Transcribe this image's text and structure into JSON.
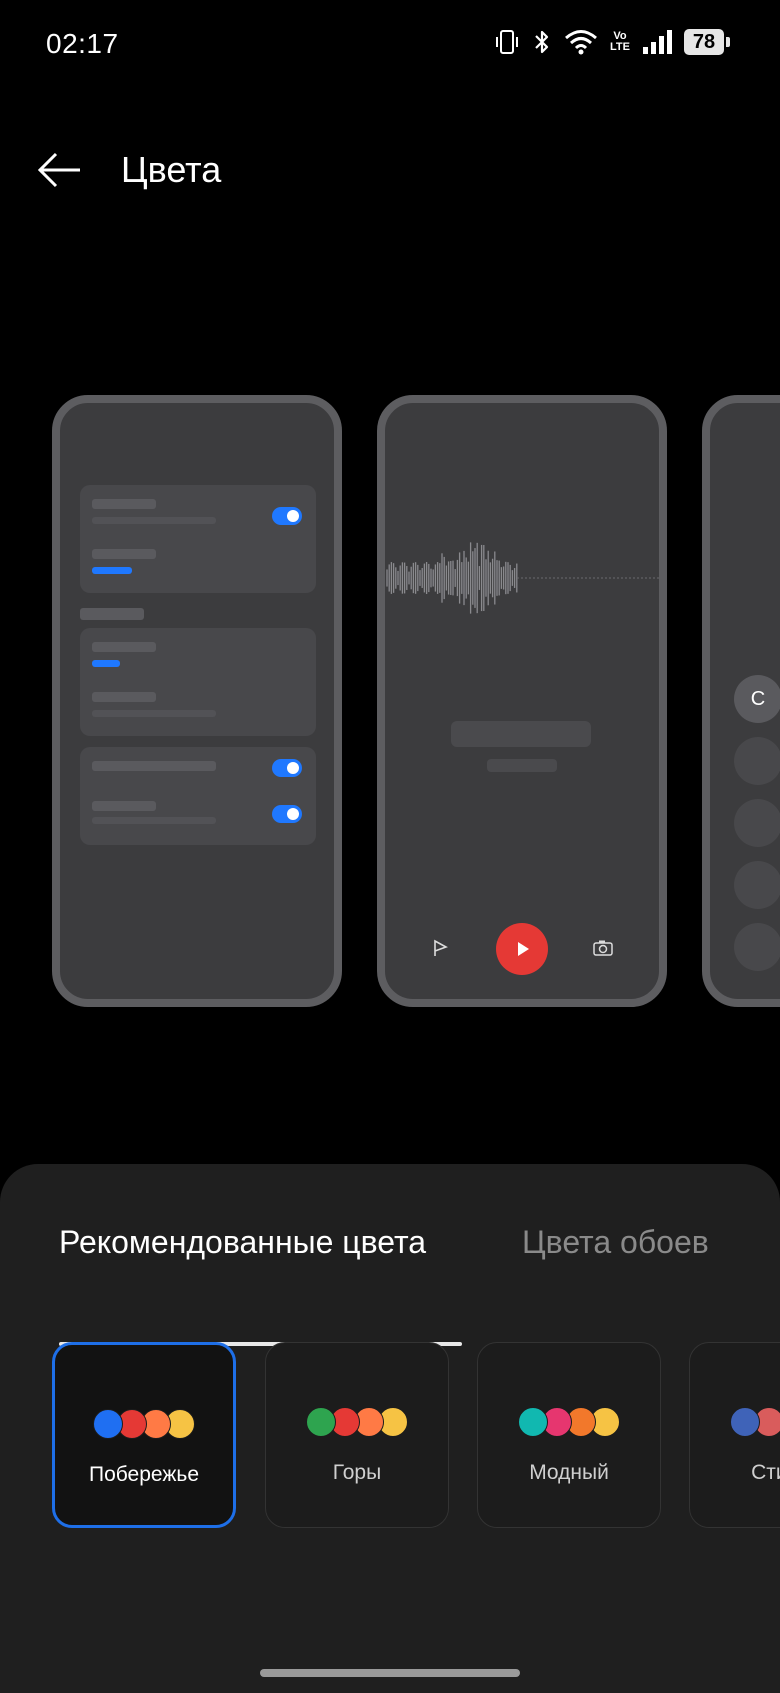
{
  "status_bar": {
    "time": "02:17",
    "lte_top": "Vo",
    "lte_bottom": "LTE",
    "battery": "78",
    "icons": [
      "vibrate-icon",
      "bluetooth-icon",
      "wifi-icon",
      "volte-icon",
      "signal-icon",
      "battery-icon"
    ]
  },
  "header": {
    "title": "Цвета",
    "back_icon": "arrow-left-icon"
  },
  "preview_3": {
    "first_key": "C"
  },
  "tabs": [
    {
      "label": "Рекомендованные цвета",
      "active": true
    },
    {
      "label": "Цвета обоев",
      "active": false
    }
  ],
  "palettes": [
    {
      "label": "Побережье",
      "selected": true,
      "colors": [
        "#1f6ff2",
        "#e53935",
        "#ff7a45",
        "#f6c344"
      ]
    },
    {
      "label": "Горы",
      "selected": false,
      "colors": [
        "#2ea44f",
        "#e53935",
        "#ff7a45",
        "#f6c344"
      ]
    },
    {
      "label": "Модный",
      "selected": false,
      "colors": [
        "#11b8b0",
        "#e6366f",
        "#f2782b",
        "#f6c344"
      ]
    },
    {
      "label": "Стиль",
      "selected": false,
      "colors": [
        "#3f63b8",
        "#d95c5c"
      ]
    }
  ],
  "colors": {
    "accent": "#1e6fe8",
    "background": "#000000",
    "sheet": "#1f1f1f"
  }
}
